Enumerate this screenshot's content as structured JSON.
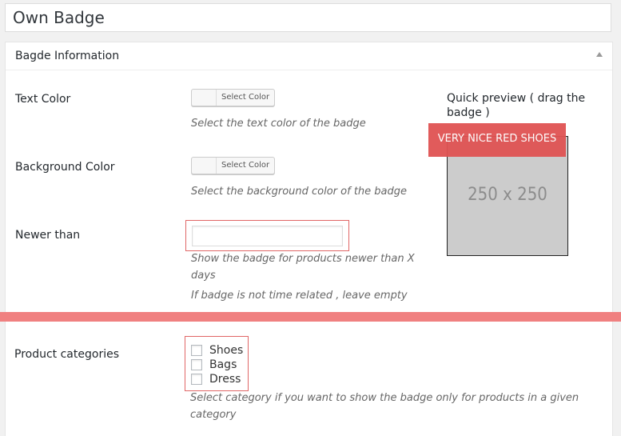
{
  "page": {
    "title": "Own Badge"
  },
  "panel": {
    "title": "Bagde Information"
  },
  "fields": {
    "text_color": {
      "label": "Text Color",
      "button_label": "Select Color",
      "description": "Select the text color of the badge"
    },
    "background_color": {
      "label": "Background Color",
      "button_label": "Select Color",
      "description": "Select the background color of the badge"
    },
    "newer_than": {
      "label": "Newer than",
      "value": "",
      "description_line1": "Show the badge for products newer than X",
      "description_line2": "days",
      "description_line3": "If badge is not time related , leave empty"
    },
    "product_categories": {
      "label": "Product categories",
      "options": [
        {
          "label": "Shoes",
          "checked": false
        },
        {
          "label": "Bags",
          "checked": false
        },
        {
          "label": "Dress",
          "checked": false
        }
      ],
      "description_line1": "Select category if you want to show the badge only for products in a given",
      "description_line2": "category"
    }
  },
  "preview": {
    "title": "Quick preview ( drag the badge )",
    "image_text": "250 x 250",
    "badge_text": "VERY NICE RED SHOES"
  },
  "colors": {
    "badge_bg": "#e05353",
    "highlight": "#e06666",
    "divider": "#f08080",
    "placeholder_bg": "#cccccc"
  }
}
